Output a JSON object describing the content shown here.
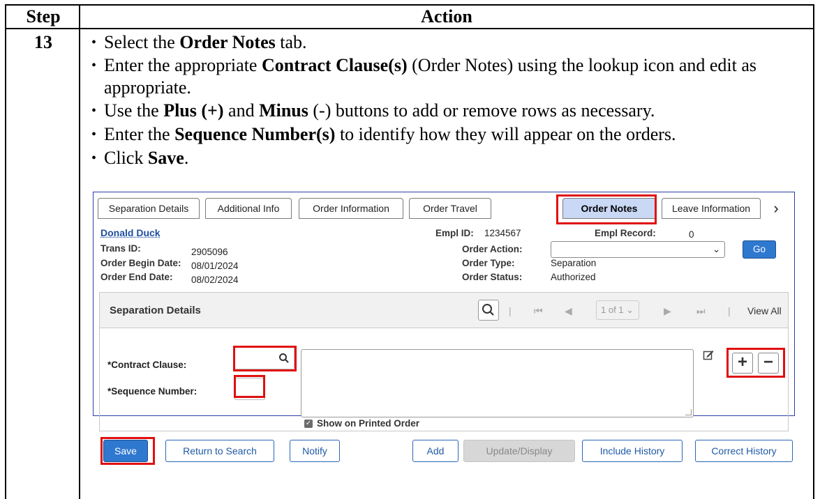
{
  "table": {
    "header_step": "Step",
    "header_action": "Action",
    "step_number": "13"
  },
  "bullets": [
    {
      "pre": "Select the ",
      "bold": "Order Notes",
      "post": " tab."
    },
    {
      "pre": "Enter the appropriate ",
      "bold": "Contract Clause(s)",
      "post": " (Order Notes) using the lookup icon and edit as appropriate."
    },
    {
      "pre": "Use the ",
      "bold": "Plus (+)",
      "mid": " and ",
      "bold2": "Minus",
      "post": " (-) buttons to add or remove rows as necessary."
    },
    {
      "pre": "Enter the ",
      "bold": "Sequence Number(s)",
      "post": " to identify how they will appear on the orders."
    },
    {
      "pre": "Click ",
      "bold": "Save",
      "post": "."
    }
  ],
  "app": {
    "tabs": [
      "Separation Details",
      "Additional Info",
      "Order Information",
      "Order Travel",
      "Order Notes",
      "Leave Information"
    ],
    "active_tab": "Order Notes",
    "employee_name": "Donald Duck",
    "empl_id_label": "Empl ID:",
    "empl_id": "1234567",
    "empl_record_label": "Empl Record:",
    "empl_record": "0",
    "trans_id_label": "Trans ID:",
    "trans_id": "2905096",
    "order_begin_label": "Order Begin Date:",
    "order_begin": "08/01/2024",
    "order_end_label": "Order End Date:",
    "order_end": "08/02/2024",
    "order_action_label": "Order Action:",
    "order_action_value": "",
    "go_label": "Go",
    "order_type_label": "Order Type:",
    "order_type": "Separation",
    "order_status_label": "Order Status:",
    "order_status": "Authorized",
    "panel_title": "Separation Details",
    "page_indicator": "1 of 1",
    "view_all": "View All",
    "contract_clause_label": "*Contract Clause:",
    "sequence_number_label": "*Sequence Number:",
    "show_on_printed_order": "Show on Printed Order",
    "buttons": {
      "save": "Save",
      "return_to_search": "Return to Search",
      "notify": "Notify",
      "add": "Add",
      "update_display": "Update/Display",
      "include_history": "Include History",
      "correct_history": "Correct History"
    },
    "highlight_color": "#e01010",
    "accent_color": "#2f78cf"
  }
}
